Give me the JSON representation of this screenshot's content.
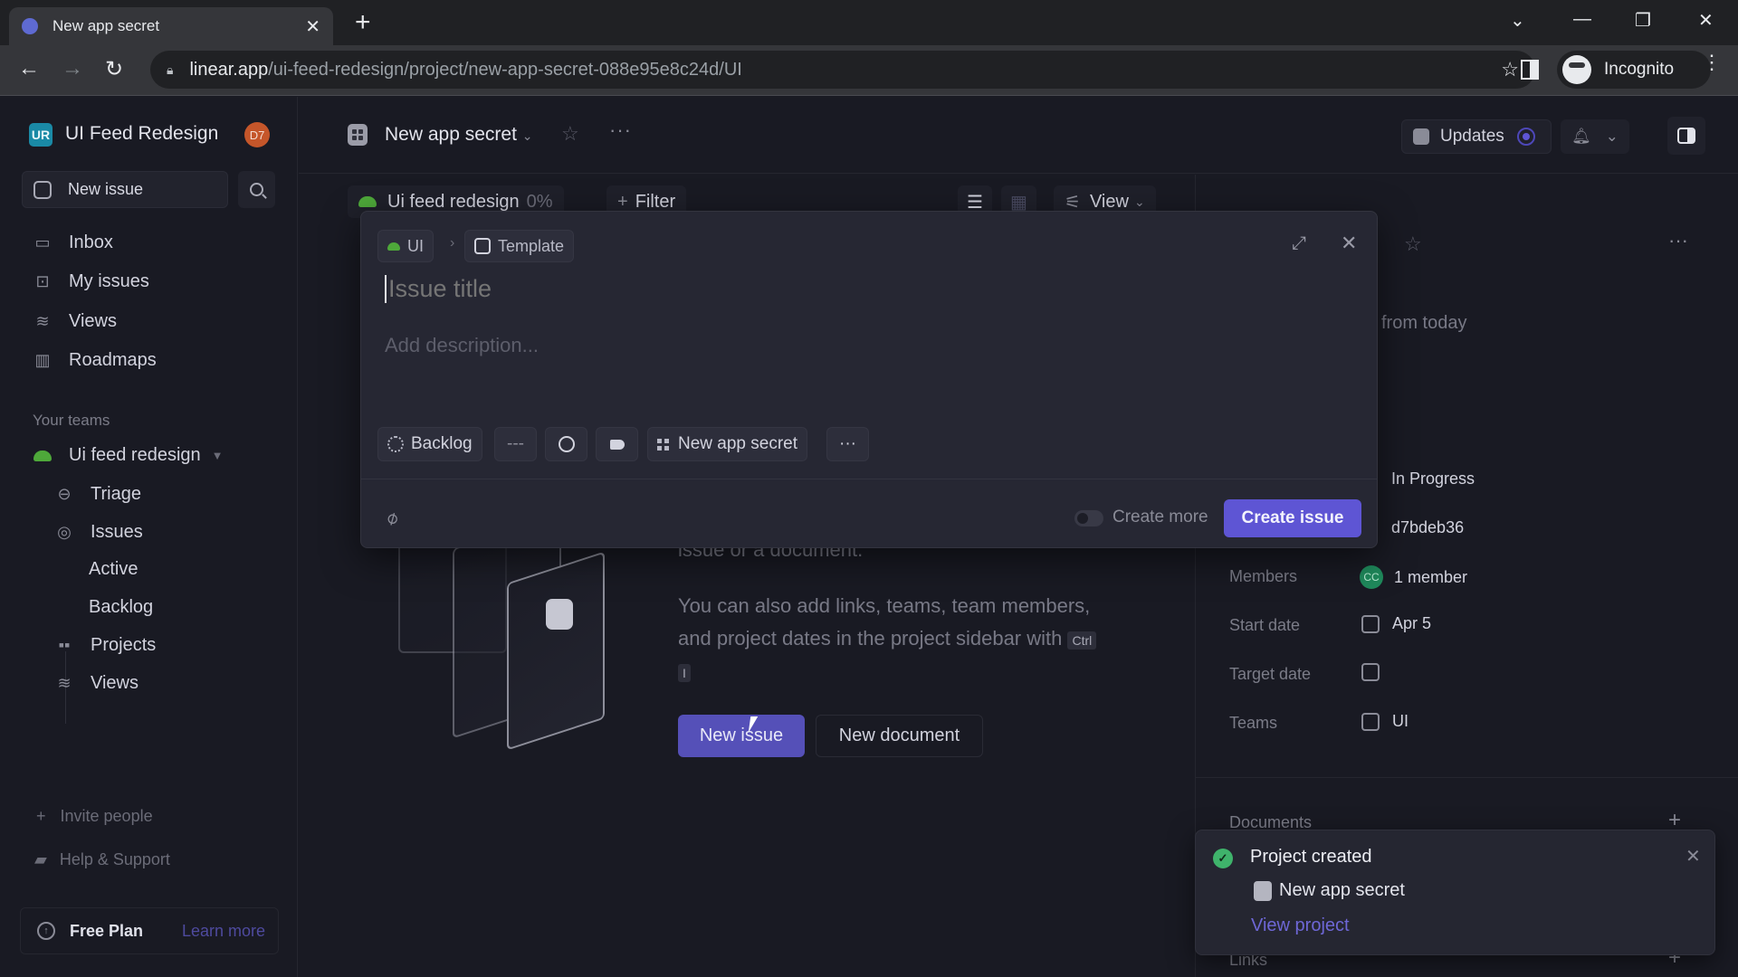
{
  "browser": {
    "tab_title": "New app secret",
    "url_host": "linear.app",
    "url_path": "/ui-feed-redesign/project/new-app-secret-088e95e8c24d/UI",
    "profile_label": "Incognito"
  },
  "sidebar": {
    "workspace_initials": "UR",
    "workspace_name": "UI Feed Redesign",
    "user_initials": "D7",
    "new_issue_label": "New issue",
    "items": [
      {
        "label": "Inbox",
        "icon": "inbox-icon"
      },
      {
        "label": "My issues",
        "icon": "my-issues-icon"
      },
      {
        "label": "Views",
        "icon": "views-icon"
      },
      {
        "label": "Roadmaps",
        "icon": "roadmap-icon"
      }
    ],
    "teams_label": "Your teams",
    "team": {
      "name": "Ui feed redesign",
      "items": [
        {
          "label": "Triage",
          "icon": "triage-icon"
        },
        {
          "label": "Issues",
          "icon": "issues-icon"
        },
        {
          "label": "Active"
        },
        {
          "label": "Backlog"
        },
        {
          "label": "Projects",
          "icon": "projects-icon"
        },
        {
          "label": "Views",
          "icon": "views-icon"
        }
      ]
    },
    "invite_label": "Invite people",
    "help_label": "Help & Support",
    "plan_label": "Free Plan",
    "learn_more_label": "Learn more"
  },
  "header": {
    "project_title": "New app secret",
    "updates_label": "Updates"
  },
  "subbar": {
    "team_chip_label": "Ui feed redesign",
    "team_chip_progress": "0%",
    "filter_label": "Filter",
    "view_label": "View"
  },
  "main": {
    "partial_text": "issue or a document.",
    "help_text": "You can also add links, teams, team members, and project dates in the project sidebar with",
    "shortcut_keys": [
      "Ctrl",
      "I"
    ],
    "new_issue_label": "New issue",
    "new_document_label": "New document"
  },
  "right_panel": {
    "partial_subtitle": "from today",
    "status_value": "In Progress",
    "lead_value": "d7bdeb36",
    "rows": [
      {
        "label": "Members",
        "value": "1 member",
        "avatar": "CC"
      },
      {
        "label": "Start date",
        "value": "Apr 5"
      },
      {
        "label": "Target date",
        "value": ""
      },
      {
        "label": "Teams",
        "value": "UI"
      }
    ],
    "documents_label": "Documents",
    "links_label": "Links"
  },
  "modal": {
    "breadcrumb_team": "UI",
    "breadcrumb_template": "Template",
    "title_placeholder": "Issue title",
    "description_placeholder": "Add description...",
    "status_label": "Backlog",
    "priority_label": "---",
    "project_label": "New app secret",
    "more_label": "···",
    "create_more_label": "Create more",
    "create_more_enabled": false,
    "create_button_label": "Create issue"
  },
  "toast": {
    "title": "Project created",
    "project_name": "New app secret",
    "link_label": "View project"
  },
  "colors": {
    "accent": "#5e55d4",
    "success": "#3fb36b",
    "team": "#4ea83a"
  }
}
